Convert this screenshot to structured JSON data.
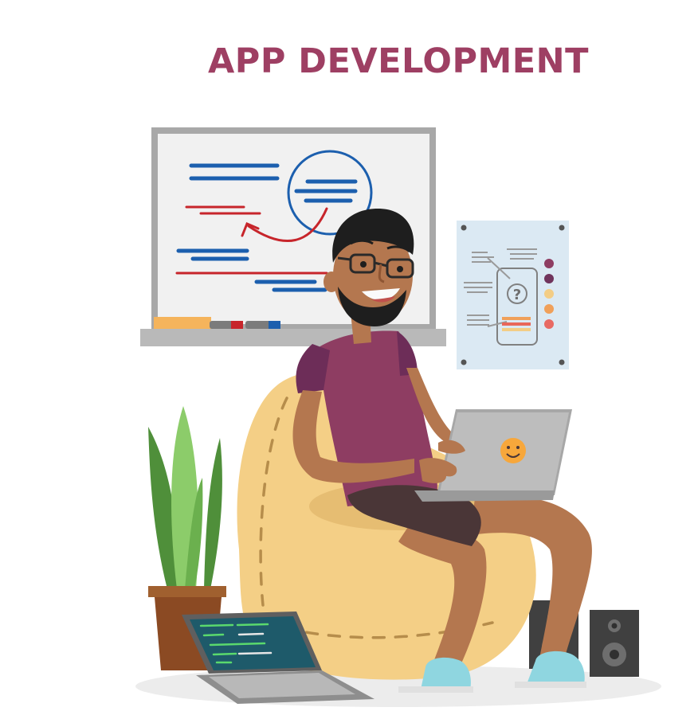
{
  "title": "APP DEVELOPMENT",
  "colors": {
    "title": "#9e3f63",
    "shirt": "#8e3d62",
    "shorts": "#4a3637",
    "skin": "#b4774f",
    "beanbag": "#f4cf86",
    "laptop": "#b4b4b4",
    "plant": "#4f8f3a",
    "whiteboard_blue": "#1c5fae",
    "whiteboard_red": "#c7252b",
    "slippers": "#8fd6e0"
  },
  "icons": {
    "laptop_sticker": "smiley-face-icon",
    "poster_icon": "question-mark-icon"
  },
  "poster": {
    "question_mark": "?"
  }
}
